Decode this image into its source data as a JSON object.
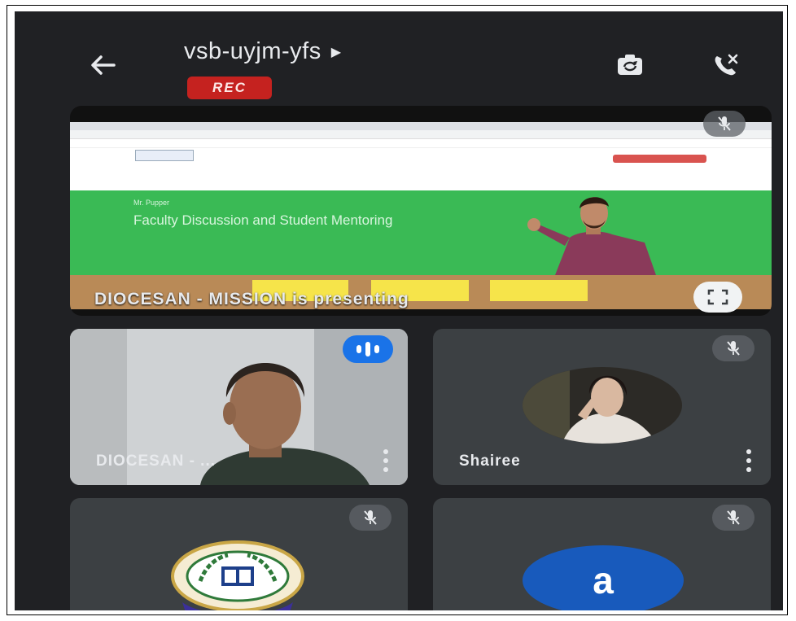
{
  "meeting": {
    "code": "vsb-uyjm-yfs",
    "rec_label": "REC"
  },
  "presentation": {
    "caption": "DIOCESAN - MISSION is presenting",
    "slide": {
      "subheading": "Mr. Pupper",
      "heading": "Faculty Discussion and Student Mentoring"
    }
  },
  "participants": [
    {
      "name": "DIOCESAN - ...",
      "speaking": true,
      "muted": false
    },
    {
      "name": "Shairee",
      "speaking": false,
      "muted": true
    },
    {
      "name": "",
      "muted": true
    },
    {
      "name": "",
      "avatar_letter": "a",
      "muted": true
    }
  ],
  "icons": {
    "back": "arrow-left-icon",
    "switch_camera": "switch-camera-icon",
    "leave_call": "phone-hangup-icon",
    "mic_off": "mic-off-icon",
    "fullscreen": "fullscreen-icon",
    "speaking": "audio-level-icon",
    "more": "more-vert-icon"
  },
  "colors": {
    "background": "#202124",
    "tile": "#3c4043",
    "rec": "#c5221f",
    "speaking": "#1a73e8",
    "avatar": "#185abc",
    "slide_green": "#3aba55"
  }
}
